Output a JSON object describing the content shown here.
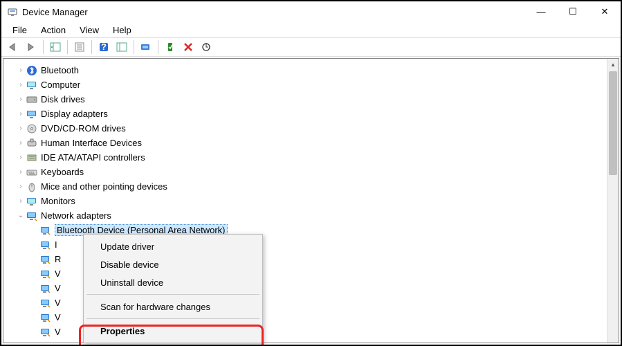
{
  "window": {
    "title": "Device Manager"
  },
  "window_controls": {
    "minimize": "—",
    "maximize": "☐",
    "close": "✕"
  },
  "menubar": [
    "File",
    "Action",
    "View",
    "Help"
  ],
  "toolbar_icons": [
    "nav-back-icon",
    "nav-forward-icon",
    "sep",
    "show-hide-tree-icon",
    "sep",
    "properties-sheet-icon",
    "sep",
    "help-icon",
    "refresh-icon",
    "sep",
    "display-icon",
    "sep",
    "enable-icon",
    "disable-icon",
    "scan-icon"
  ],
  "tree": {
    "root": [
      {
        "label": "Bluetooth",
        "icon": "bluetooth",
        "expanded": false
      },
      {
        "label": "Computer",
        "icon": "monitor",
        "expanded": false
      },
      {
        "label": "Disk drives",
        "icon": "disk",
        "expanded": false
      },
      {
        "label": "Display adapters",
        "icon": "display",
        "expanded": false
      },
      {
        "label": "DVD/CD-ROM drives",
        "icon": "dvd",
        "expanded": false
      },
      {
        "label": "Human Interface Devices",
        "icon": "hid",
        "expanded": false
      },
      {
        "label": "IDE ATA/ATAPI controllers",
        "icon": "ide",
        "expanded": false
      },
      {
        "label": "Keyboards",
        "icon": "keyboard",
        "expanded": false
      },
      {
        "label": "Mice and other pointing devices",
        "icon": "mouse",
        "expanded": false
      },
      {
        "label": "Monitors",
        "icon": "monitor",
        "expanded": false
      },
      {
        "label": "Network adapters",
        "icon": "network",
        "expanded": true,
        "children": [
          {
            "label": "Bluetooth Device (Personal Area Network)",
            "selected": true
          },
          {
            "label": "I"
          },
          {
            "label": "R"
          },
          {
            "label": "V"
          },
          {
            "label": "V"
          },
          {
            "label": "V"
          },
          {
            "label": "V"
          },
          {
            "label": "V"
          }
        ]
      }
    ]
  },
  "context_menu": {
    "items": [
      {
        "label": "Update driver"
      },
      {
        "label": "Disable device"
      },
      {
        "label": "Uninstall device"
      },
      {
        "sep": true
      },
      {
        "label": "Scan for hardware changes"
      },
      {
        "sep": true
      },
      {
        "label": "Properties",
        "bold": true,
        "highlighted": true
      }
    ]
  }
}
